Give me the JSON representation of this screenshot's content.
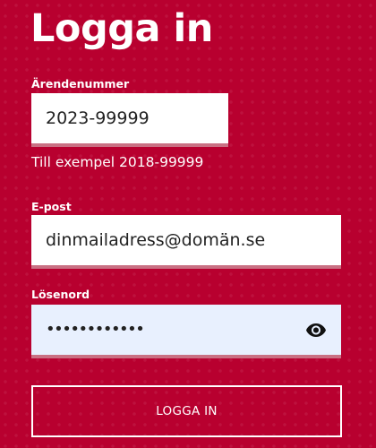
{
  "page": {
    "title": "Logga in"
  },
  "form": {
    "case_number": {
      "label": "Ärendenummer",
      "value": "2023-99999",
      "hint": "Till exempel 2018-99999"
    },
    "email": {
      "label": "E-post",
      "value": "dinmailadress@domän.se"
    },
    "password": {
      "label": "Lösenord",
      "masked_value": "••••••••••••",
      "toggle_icon": "eye-icon"
    },
    "submit_label": "LOGGA IN"
  },
  "colors": {
    "background": "#b8002f",
    "input_background": "#ffffff",
    "autofill_background": "#e8f0fe",
    "input_underline": "#c97083",
    "text_light": "#ffffff",
    "text_dark": "#222222"
  }
}
